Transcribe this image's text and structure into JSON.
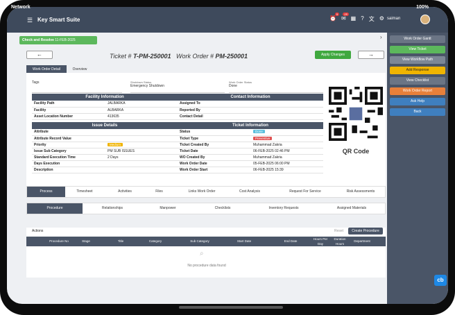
{
  "status": {
    "network": "Network",
    "battery": "100%"
  },
  "header": {
    "title": "Key Smart Suite",
    "user": "saiman",
    "notif_badges": [
      "9",
      "28",
      ""
    ]
  },
  "alert": {
    "text": "Check and Resolve",
    "date": "11-FEB-2025"
  },
  "nav": {
    "prev": "←",
    "next": "→",
    "ticket_label": "Ticket #",
    "ticket_value": "T-PM-250001",
    "wo_label": "Work Order #",
    "wo_value": "PM-250001",
    "apply": "Apply Changes"
  },
  "detail_tabs": [
    "Work Order Detail",
    "Overview"
  ],
  "dropdowns": {
    "tags": {
      "label": "Tags",
      "value": ""
    },
    "shutdown": {
      "label": "Shutdown Status",
      "value": "Emergency Shutdown"
    },
    "wo_status": {
      "label": "Work Order Status",
      "value": "Done"
    }
  },
  "facility": {
    "title": "Facility Information",
    "rows": [
      {
        "k": "Facility Path",
        "v": "JALBARKA"
      },
      {
        "k": "Facility",
        "v": "ALBARKA"
      },
      {
        "k": "Asset Location Number",
        "v": "413635"
      }
    ]
  },
  "contact": {
    "title": "Contact Information",
    "rows": [
      {
        "k": "Assigned To",
        "v": ""
      },
      {
        "k": "Reported By",
        "v": ""
      },
      {
        "k": "Contact Detail",
        "v": ""
      }
    ]
  },
  "issue": {
    "title": "Issue Details",
    "rows": [
      {
        "k": "Attribute",
        "v": ""
      },
      {
        "k": "Attribute Record Value",
        "v": ""
      },
      {
        "k": "Priority",
        "v": "Medium"
      },
      {
        "k": "Issue Sub Category",
        "v": "PM SUB ISSUES"
      },
      {
        "k": "Standard Execution Time",
        "v": "2 Days"
      },
      {
        "k": "Days Execution",
        "v": ""
      },
      {
        "k": "Description",
        "v": ""
      }
    ]
  },
  "ticket": {
    "title": "Ticket Information",
    "rows": [
      {
        "k": "Status",
        "v": "Done"
      },
      {
        "k": "Ticket Type",
        "v": "Preventive"
      },
      {
        "k": "Ticket Created By",
        "v": "Muhammad Zakria"
      },
      {
        "k": "Ticket Date",
        "v": "06-FEB-2025 02:46 PM"
      },
      {
        "k": "WO Created By",
        "v": "Muhammad Zakria"
      },
      {
        "k": "Work Order Date",
        "v": "05-FEB-2025 06:00 PM"
      },
      {
        "k": "Work Order Start",
        "v": "06-FEB-2025 15:39"
      }
    ]
  },
  "qr": {
    "label": "QR Code"
  },
  "process_tabs": [
    "Process",
    "Timesheet",
    "Activities",
    "Files",
    "Links Work Order",
    "Cost Analysis",
    "Request For Service",
    "Risk Assessments"
  ],
  "sub_tabs": [
    "Procedure",
    "Relationships",
    "Manpower",
    "Checklists",
    "Inventory Requests",
    "Assigned Materials"
  ],
  "grid": {
    "actions": "Actions",
    "reset": "Reset",
    "create": "Create Procedure",
    "columns": [
      "Procedure No",
      "Stage",
      "Title",
      "Category",
      "Sub Category",
      "Start Date",
      "End Date",
      "Hours Per Day",
      "Duration Hours",
      "Department"
    ],
    "empty": "No procedure data found"
  },
  "right_panel": [
    {
      "label": "Work Order Gantt",
      "color": "#6b7585"
    },
    {
      "label": "View Ticket",
      "color": "#5cb85c"
    },
    {
      "label": "View Workflow Path",
      "color": "#7d8796"
    },
    {
      "label": "Add Response",
      "color": "#f0b400"
    },
    {
      "label": "View Checklist",
      "color": "#6b7585"
    },
    {
      "label": "Work Order Report",
      "color": "#e8803a"
    },
    {
      "label": "Ask Help",
      "color": "#3f7fbf"
    },
    {
      "label": "Back",
      "color": "#3f7fbf"
    }
  ],
  "chat": "cb"
}
